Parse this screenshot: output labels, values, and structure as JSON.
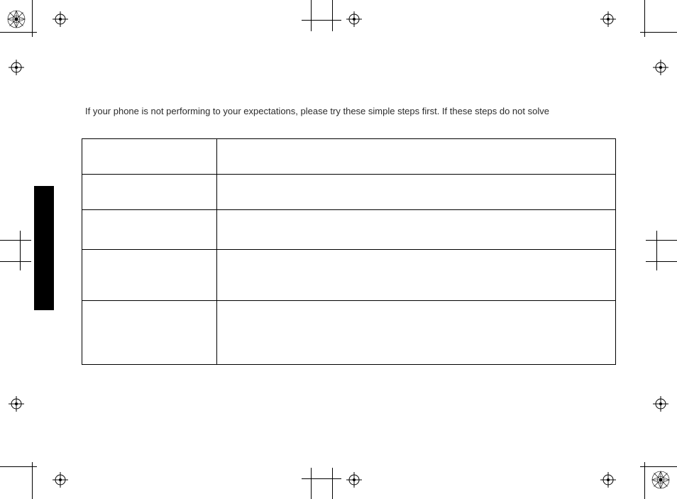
{
  "intro_text": "If your phone is not performing to your expectations, please try these simple steps first. If these steps do not solve",
  "table": {
    "headers": {
      "problem": "",
      "steps": ""
    },
    "rows": [
      {
        "problem": "",
        "steps": ""
      },
      {
        "problem": "",
        "steps": ""
      },
      {
        "problem": "",
        "steps": ""
      },
      {
        "problem": "",
        "steps": ""
      }
    ]
  }
}
